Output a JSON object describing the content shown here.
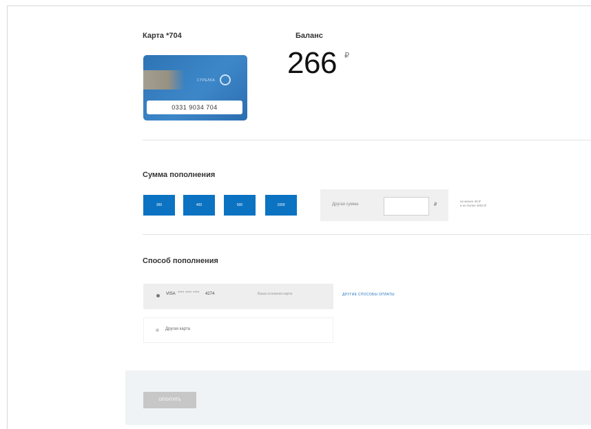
{
  "card": {
    "title": "Карта *704",
    "logo_text": "СТРЕЛКА",
    "number": "0331 9034 704"
  },
  "balance": {
    "title": "Баланс",
    "value": "266",
    "currency": "₽"
  },
  "topup": {
    "title": "Сумма пополнения",
    "amounts": [
      "300",
      "400",
      "500",
      "1000"
    ],
    "other_label": "Другая сумма",
    "other_value": "",
    "currency": "₽",
    "limits": [
      "не менее 30 ₽",
      "и не более 4003 ₽"
    ]
  },
  "method": {
    "title": "Способ пополнения",
    "saved_card": {
      "brand": "VISA",
      "mask": "**** **** ****",
      "last4": "4274",
      "note": "Ваша основная карта"
    },
    "other_methods_link": "ДРУГИЕ СПОСОБЫ ОПЛАТЫ",
    "other_card_label": "Другая карта"
  },
  "footer": {
    "pay_label": "ОПЛАТИТЬ"
  },
  "colors": {
    "accent": "#0b73c2",
    "card": "#2e74b5",
    "disabled": "#c7c7c7"
  }
}
